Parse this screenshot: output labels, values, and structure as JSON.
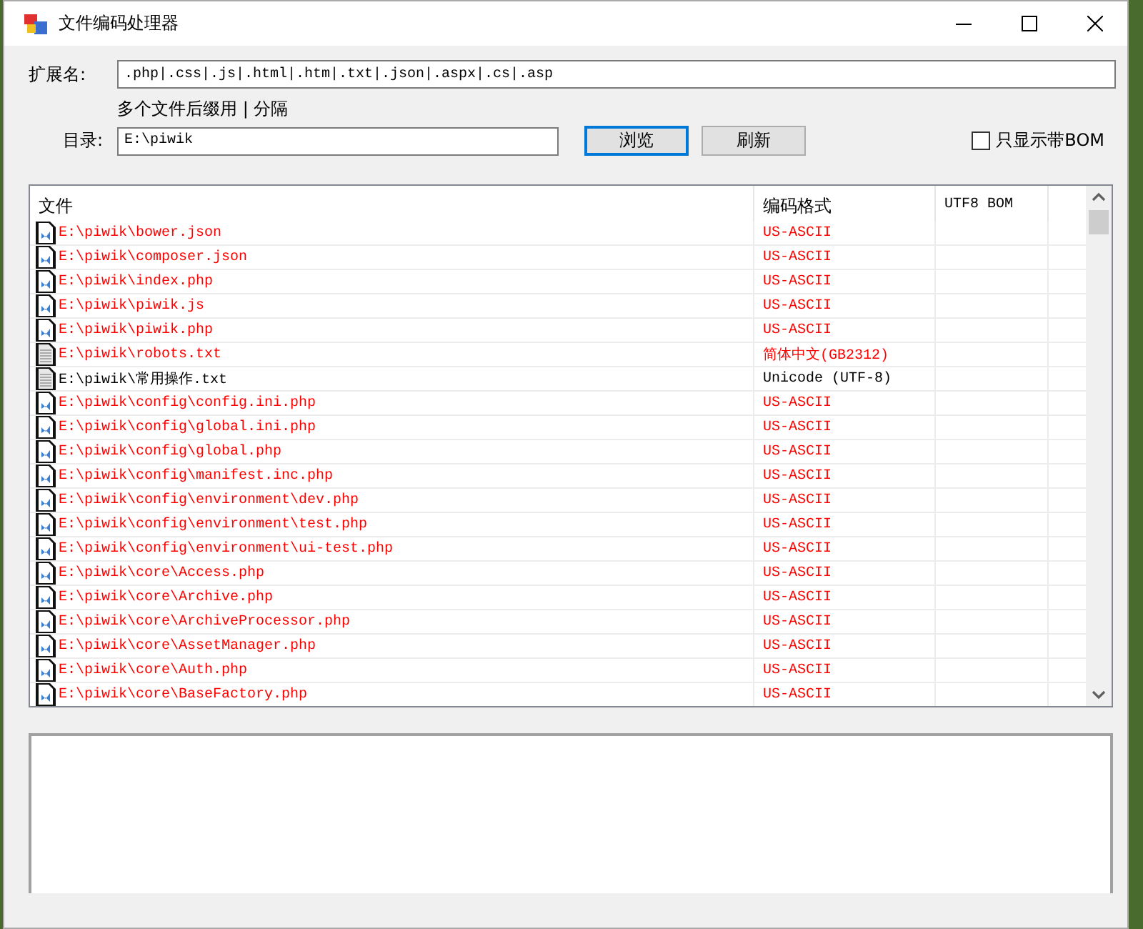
{
  "window": {
    "title": "文件编码处理器"
  },
  "extension": {
    "label": "扩展名:",
    "value": ".php|.css|.js|.html|.htm|.txt|.json|.aspx|.cs|.asp",
    "hint": "多个文件后缀用 | 分隔"
  },
  "directory": {
    "label": "目录:",
    "value": "E:\\piwik"
  },
  "buttons": [
    {
      "label": "浏览",
      "default": true
    },
    {
      "label": "刷新",
      "default": false
    }
  ],
  "bom_only": {
    "label": "只显示带BOM",
    "checked": false
  },
  "table": {
    "columns": [
      "文件",
      "编码格式",
      "UTF8 BOM"
    ],
    "rows": [
      {
        "kind": "code",
        "file": "E:\\piwik\\bower.json",
        "encoding": "US-ASCII",
        "flagged": true
      },
      {
        "kind": "code",
        "file": "E:\\piwik\\composer.json",
        "encoding": "US-ASCII",
        "flagged": true
      },
      {
        "kind": "code",
        "file": "E:\\piwik\\index.php",
        "encoding": "US-ASCII",
        "flagged": true
      },
      {
        "kind": "code",
        "file": "E:\\piwik\\piwik.js",
        "encoding": "US-ASCII",
        "flagged": true
      },
      {
        "kind": "code",
        "file": "E:\\piwik\\piwik.php",
        "encoding": "US-ASCII",
        "flagged": true
      },
      {
        "kind": "text",
        "file": "E:\\piwik\\robots.txt",
        "encoding": "简体中文(GB2312)",
        "flagged": true
      },
      {
        "kind": "text",
        "file": "E:\\piwik\\常用操作.txt",
        "encoding": "Unicode (UTF-8)",
        "flagged": false
      },
      {
        "kind": "code",
        "file": "E:\\piwik\\config\\config.ini.php",
        "encoding": "US-ASCII",
        "flagged": true
      },
      {
        "kind": "code",
        "file": "E:\\piwik\\config\\global.ini.php",
        "encoding": "US-ASCII",
        "flagged": true
      },
      {
        "kind": "code",
        "file": "E:\\piwik\\config\\global.php",
        "encoding": "US-ASCII",
        "flagged": true
      },
      {
        "kind": "code",
        "file": "E:\\piwik\\config\\manifest.inc.php",
        "encoding": "US-ASCII",
        "flagged": true
      },
      {
        "kind": "code",
        "file": "E:\\piwik\\config\\environment\\dev.php",
        "encoding": "US-ASCII",
        "flagged": true
      },
      {
        "kind": "code",
        "file": "E:\\piwik\\config\\environment\\test.php",
        "encoding": "US-ASCII",
        "flagged": true
      },
      {
        "kind": "code",
        "file": "E:\\piwik\\config\\environment\\ui-test.php",
        "encoding": "US-ASCII",
        "flagged": true
      },
      {
        "kind": "code",
        "file": "E:\\piwik\\core\\Access.php",
        "encoding": "US-ASCII",
        "flagged": true
      },
      {
        "kind": "code",
        "file": "E:\\piwik\\core\\Archive.php",
        "encoding": "US-ASCII",
        "flagged": true
      },
      {
        "kind": "code",
        "file": "E:\\piwik\\core\\ArchiveProcessor.php",
        "encoding": "US-ASCII",
        "flagged": true
      },
      {
        "kind": "code",
        "file": "E:\\piwik\\core\\AssetManager.php",
        "encoding": "US-ASCII",
        "flagged": true
      },
      {
        "kind": "code",
        "file": "E:\\piwik\\core\\Auth.php",
        "encoding": "US-ASCII",
        "flagged": true
      },
      {
        "kind": "code",
        "file": "E:\\piwik\\core\\BaseFactory.php",
        "encoding": "US-ASCII",
        "flagged": true
      }
    ]
  }
}
